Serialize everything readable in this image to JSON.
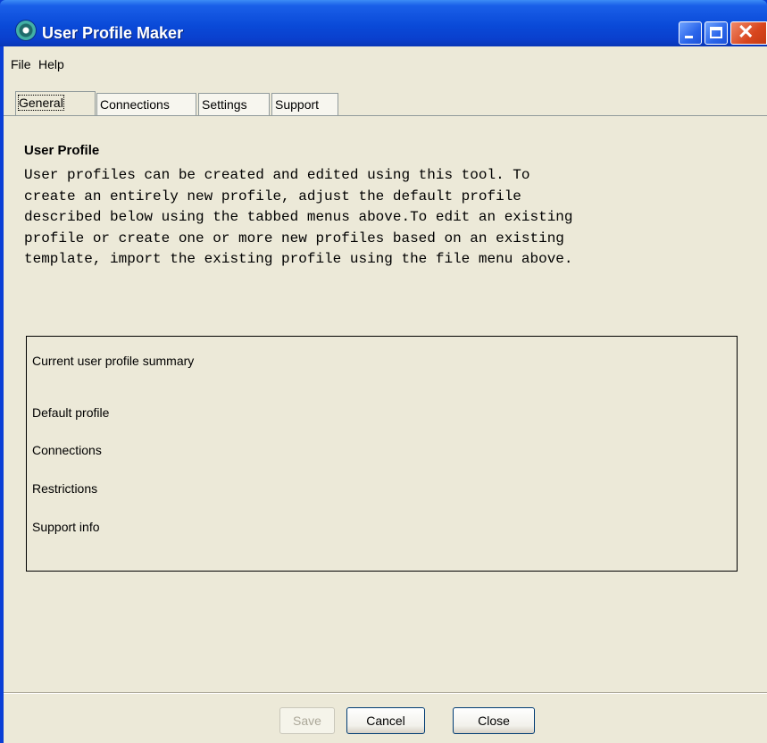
{
  "window": {
    "title": "User Profile Maker"
  },
  "menu": {
    "items": [
      "File",
      "Help"
    ]
  },
  "tabs": [
    "General",
    "Connections",
    "Settings",
    "Support"
  ],
  "active_tab": "General",
  "general": {
    "heading": "User Profile",
    "paragraph_lines": [
      "User profiles can be created and edited using this tool. To",
      "create an entirely new profile, adjust the default profile",
      "described below using the tabbed menus above.To edit an existing",
      "profile or create one or more new profiles based on an existing",
      "template, import the existing profile using the file menu above."
    ],
    "summary": {
      "title": "Current user profile summary",
      "items": [
        "Default profile",
        "Connections",
        "Restrictions",
        "Support info"
      ]
    }
  },
  "buttons": {
    "save": "Save",
    "cancel": "Cancel",
    "close": "Close"
  },
  "colors": {
    "titlebar": "#0a4ad8",
    "client_bg": "#ece9d8",
    "close_button": "#d8461e"
  }
}
